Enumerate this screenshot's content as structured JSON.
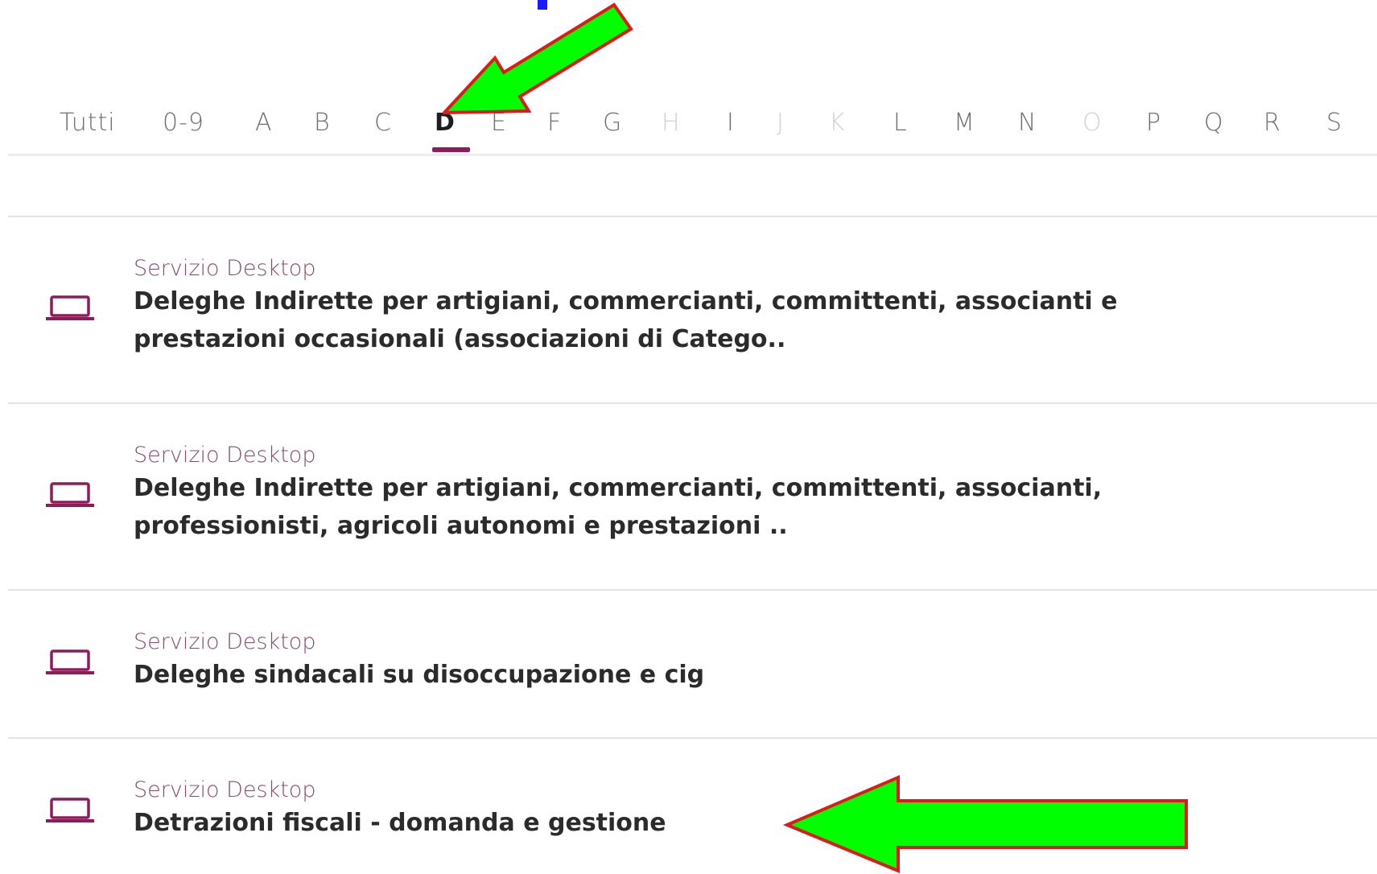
{
  "annotation_colors": {
    "arrow_fill": "#00ff00",
    "arrow_stroke": "#e0191b",
    "caption": "#1a1aff"
  },
  "accent_color": "#8e1b5a",
  "alphabet_filter": {
    "items": [
      {
        "label": "Tutti",
        "state": "enabled"
      },
      {
        "label": "0-9",
        "state": "enabled"
      },
      {
        "label": "A",
        "state": "enabled"
      },
      {
        "label": "B",
        "state": "enabled"
      },
      {
        "label": "C",
        "state": "enabled"
      },
      {
        "label": "D",
        "state": "active"
      },
      {
        "label": "E",
        "state": "enabled"
      },
      {
        "label": "F",
        "state": "enabled"
      },
      {
        "label": "G",
        "state": "enabled"
      },
      {
        "label": "H",
        "state": "disabled"
      },
      {
        "label": "I",
        "state": "enabled"
      },
      {
        "label": "J",
        "state": "disabled"
      },
      {
        "label": "K",
        "state": "disabled"
      },
      {
        "label": "L",
        "state": "enabled"
      },
      {
        "label": "M",
        "state": "enabled"
      },
      {
        "label": "N",
        "state": "enabled"
      },
      {
        "label": "O",
        "state": "disabled"
      },
      {
        "label": "P",
        "state": "enabled"
      },
      {
        "label": "Q",
        "state": "enabled"
      },
      {
        "label": "R",
        "state": "enabled"
      },
      {
        "label": "S",
        "state": "enabled"
      }
    ]
  },
  "results": [
    {
      "icon": "laptop-icon",
      "type": "Servizio Desktop",
      "title_lines": [
        "Deleghe Indirette per artigiani, commercianti, committenti, associanti e",
        "prestazioni occasionali (associazioni di Catego.."
      ]
    },
    {
      "icon": "laptop-icon",
      "type": "Servizio Desktop",
      "title_lines": [
        "Deleghe Indirette per artigiani, commercianti, committenti, associanti,",
        "professionisti, agricoli autonomi e prestazioni .."
      ]
    },
    {
      "icon": "laptop-icon",
      "type": "Servizio Desktop",
      "title_lines": [
        "Deleghe sindacali su disoccupazione e cig"
      ]
    },
    {
      "icon": "laptop-icon",
      "type": "Servizio Desktop",
      "title_lines": [
        "Detrazioni fiscali - domanda e gestione"
      ]
    }
  ]
}
